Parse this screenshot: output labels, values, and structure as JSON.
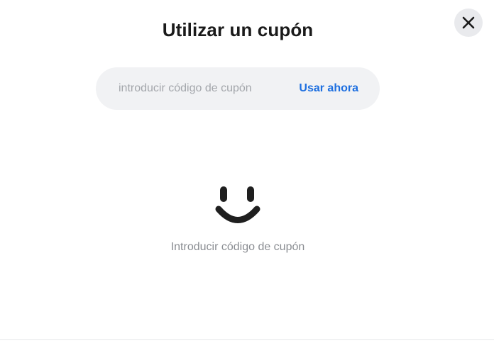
{
  "modal": {
    "title": "Utilizar un cupón",
    "close_icon": "close-icon"
  },
  "coupon": {
    "input_value": "",
    "placeholder": "introducir código de cupón",
    "submit_label": "Usar ahora"
  },
  "empty_state": {
    "icon": "smiley-icon",
    "message": "Introducir código de cupón"
  },
  "colors": {
    "accent": "#1d6fe0",
    "input_bg": "#f1f2f4",
    "close_bg": "#e9eaed",
    "title": "#1a1a1a",
    "muted_text": "#8a8d92"
  }
}
